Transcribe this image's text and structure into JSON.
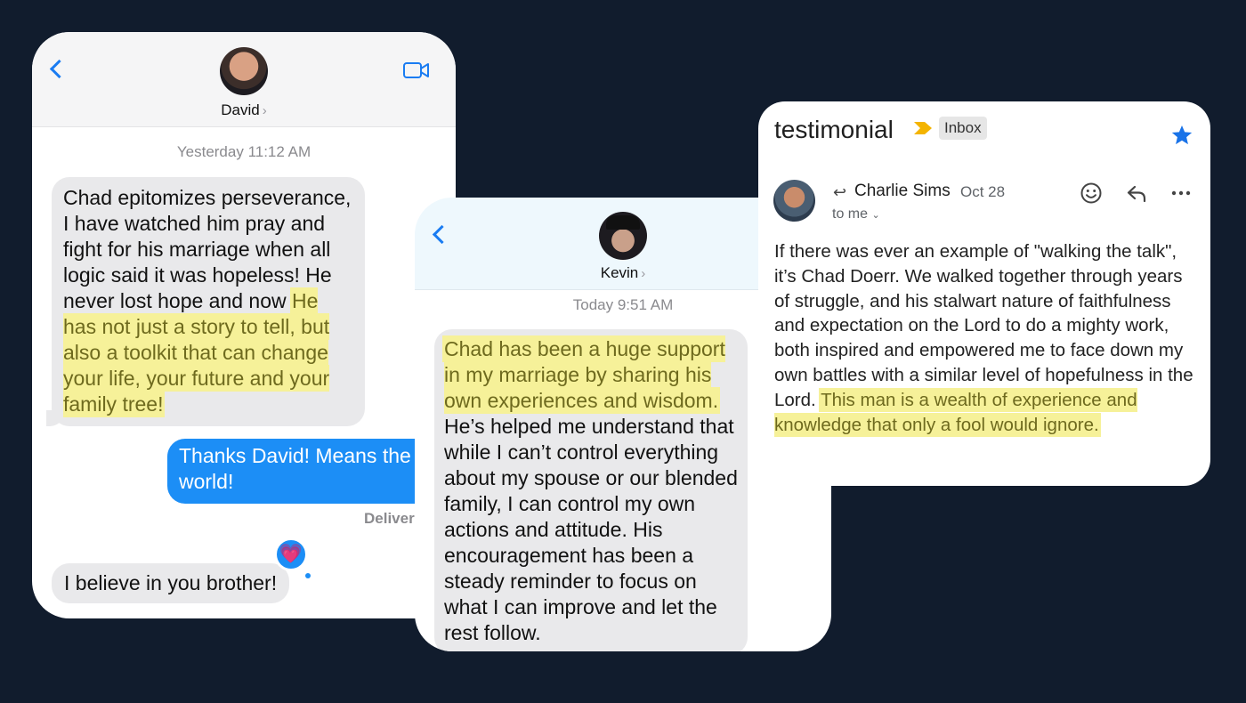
{
  "david_chat": {
    "contact_name": "David",
    "timestamp": "Yesterday 11:12 AM",
    "received_message": {
      "text": "Chad epitomizes perseverance, I have watched him pray and fight for his marriage when all logic said it was hopeless! He never lost hope and now ",
      "highlight": "He has not just a story to tell, but also a toolkit that can change your life, your future and your family tree!"
    },
    "sent_message": "Thanks David! Means the world!",
    "delivery_status": "Deliver",
    "second_message": "I believe in you brother!",
    "reaction": "💗"
  },
  "kevin_chat": {
    "contact_name": "Kevin",
    "timestamp": "Today 9:51 AM",
    "message": {
      "highlight": "Chad has been a huge support in my marriage by sharing his own experiences and wisdom.",
      "text": " He’s helped me understand that while I can’t control everything about my spouse or our blended family, I can control my own actions and attitude. His encouragement has been a steady reminder to focus on what I can improve and let the rest follow."
    }
  },
  "email": {
    "subject": "testimonial",
    "label": "Inbox",
    "sender": "Charlie Sims",
    "date": "Oct 28",
    "recipient": "to me",
    "body": "If there was ever an example of \"walking the talk\", it’s Chad Doerr.  We walked together through years of struggle, and his stalwart nature of faithfulness and expectation on the Lord to do a mighty work, both inspired and empowered me to face down my own battles with a similar level of hopefulness in the Lord. ",
    "body_highlight": "This man is a wealth of experience and knowledge that only a fool would ignore."
  },
  "colors": {
    "background": "#111c2d",
    "imessage_blue": "#1c8ef6",
    "highlight": "#f6f199",
    "star": "#1a73e8",
    "importance": "#f4b400"
  },
  "icons": [
    "back-chevron-icon",
    "video-call-icon",
    "heart-reaction-icon",
    "importance-marker-icon",
    "star-icon",
    "reply-icon",
    "emoji-icon",
    "more-icon"
  ]
}
